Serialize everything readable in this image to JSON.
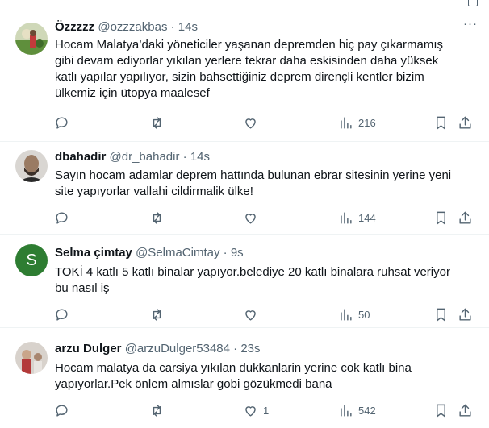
{
  "tweets": [
    {
      "name": "Özzzzz",
      "handle": "@ozzzakbas",
      "sep": "·",
      "time": "14s",
      "lines": [
        "Hocam Malatya’daki yöneticiler  yaşanan depremden hiç pay çıkarmamış",
        "gibi devam ediyorlar yıkılan yerlere tekrar daha eskisinden daha yüksek",
        "katlı yapılar yapılıyor, sizin bahsettiğiniz deprem dirençli kentler bizim",
        "ülkemiz için ütopya maalesef"
      ],
      "replies": "",
      "retweets": "",
      "likes": "",
      "views": "216",
      "avatar": {
        "type": "photo",
        "colors": [
          "#5f8f3c",
          "#c9b98a"
        ]
      }
    },
    {
      "name": "dbahadir",
      "handle": "@dr_bahadir",
      "sep": "·",
      "time": "14s",
      "lines": [
        "Sayın hocam adamlar deprem hattında bulunan ebrar sitesinin yerine yeni",
        "site yapıyorlar vallahi cildirmalik ülke!"
      ],
      "replies": "",
      "retweets": "",
      "likes": "",
      "views": "144",
      "avatar": {
        "type": "photo",
        "colors": [
          "#3b2f28",
          "#9a7b63"
        ]
      }
    },
    {
      "name": "Selma çimtay",
      "handle": "@SelmaCimtay",
      "sep": "·",
      "time": "9s",
      "lines": [
        "TOKİ 4 katlı 5 katlı binalar yapıyor.belediye 20 katlı binalara ruhsat veriyor",
        "bu nasıl iş"
      ],
      "replies": "",
      "retweets": "",
      "likes": "",
      "views": "50",
      "avatar": {
        "type": "letter",
        "letter": "S",
        "colors": [
          "#2e7d32",
          "#ffffff"
        ]
      }
    },
    {
      "name": "arzu Dulger",
      "handle": "@arzuDulger53484",
      "sep": "·",
      "time": "23s",
      "lines": [
        "Hocam malatya da carsiya yıkılan dukkanlarin yerine cok katlı bina",
        "yapıyorlar.Pek önlem almıslar gobi gözükmedi bana"
      ],
      "replies": "",
      "retweets": "",
      "likes": "1",
      "views": "542",
      "avatar": {
        "type": "photo",
        "colors": [
          "#d8d2cc",
          "#b33a3a"
        ]
      }
    }
  ],
  "more_glyph": "···"
}
